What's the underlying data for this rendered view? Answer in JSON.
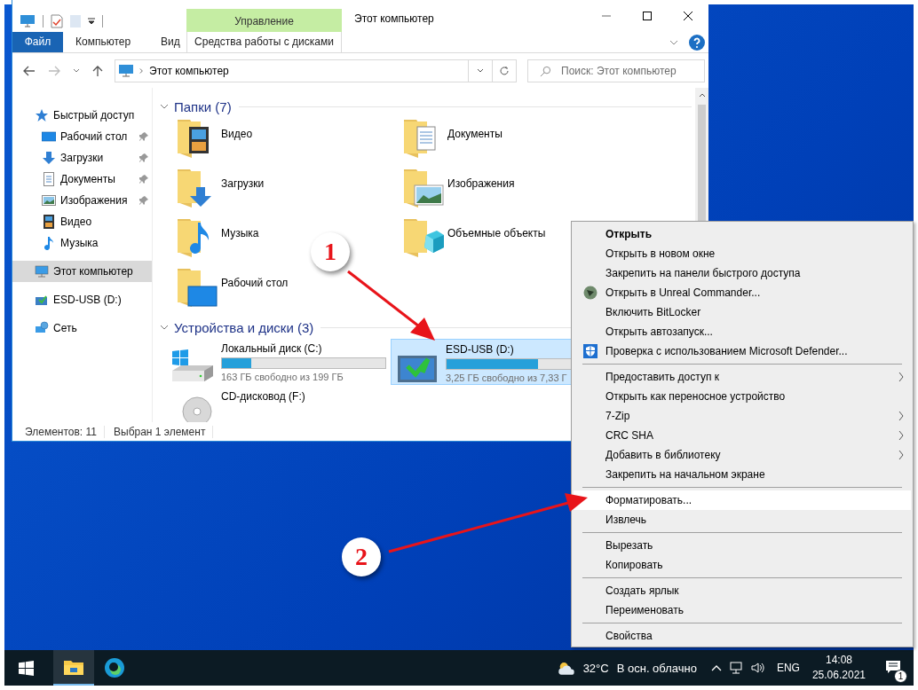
{
  "window": {
    "title": "Этот компьютер",
    "context_tab_group": "Управление"
  },
  "ribbon_tabs": [
    {
      "label": "Файл",
      "kind": "file",
      "selected": false
    },
    {
      "label": "Компьютер",
      "kind": "tab",
      "selected": false
    },
    {
      "label": "Вид",
      "kind": "tab",
      "selected": false
    },
    {
      "label": "Средства работы с дисками",
      "kind": "context",
      "selected": false
    }
  ],
  "address_bar": {
    "path": "Этот компьютер"
  },
  "search": {
    "placeholder": "Поиск: Этот компьютер"
  },
  "navigation": [
    {
      "label": "Быстрый доступ",
      "kind": "star",
      "selected": false,
      "children": [
        {
          "label": "Рабочий стол",
          "kind": "desktop",
          "pinned": true,
          "selected": false
        },
        {
          "label": "Загрузки",
          "kind": "downloads",
          "pinned": true,
          "selected": false
        },
        {
          "label": "Документы",
          "kind": "documents",
          "pinned": true,
          "selected": false
        },
        {
          "label": "Изображения",
          "kind": "images",
          "pinned": true,
          "selected": false
        },
        {
          "label": "Видео",
          "kind": "video",
          "pinned": false,
          "selected": false
        },
        {
          "label": "Музыка",
          "kind": "music",
          "pinned": false,
          "selected": false
        }
      ]
    },
    {
      "label": "Этот компьютер",
      "kind": "pc",
      "selected": true
    },
    {
      "label": "ESD-USB (D:)",
      "kind": "usb",
      "selected": false
    },
    {
      "label": "Сеть",
      "kind": "network",
      "selected": false
    }
  ],
  "folders_section": {
    "title": "Папки (7)",
    "expanded": true,
    "items": [
      {
        "name": "Видео",
        "kind": "video"
      },
      {
        "name": "Документы",
        "kind": "documents"
      },
      {
        "name": "Загрузки",
        "kind": "downloads"
      },
      {
        "name": "Изображения",
        "kind": "images"
      },
      {
        "name": "Музыка",
        "kind": "music"
      },
      {
        "name": "Объемные объекты",
        "kind": "objects3d"
      },
      {
        "name": "Рабочий стол",
        "kind": "desktop"
      }
    ]
  },
  "drives_section": {
    "title": "Устройства и диски (3)",
    "expanded": true,
    "items": [
      {
        "name": "Локальный диск (C:)",
        "kind": "system",
        "level": 0.18,
        "free": "163 ГБ свободно из 199 ГБ",
        "selected": false
      },
      {
        "name": "ESD-USB (D:)",
        "kind": "usb",
        "level": 0.56,
        "free": "3,25 ГБ свободно из 7,33 Г",
        "selected": true
      },
      {
        "name": "CD-дисковод (F:)",
        "kind": "cd",
        "selected": false
      }
    ]
  },
  "status_bar": [
    "Элементов: 11",
    "Выбран 1 элемент"
  ],
  "context_menu": {
    "groups": [
      [
        {
          "label": "Открыть",
          "kind": "plain",
          "default": true,
          "submenu": false,
          "selected": false
        },
        {
          "label": "Открыть в новом окне",
          "kind": "plain",
          "default": false,
          "submenu": false,
          "selected": false
        },
        {
          "label": "Закрепить на панели быстрого доступа",
          "kind": "plain",
          "default": false,
          "submenu": false,
          "selected": false
        },
        {
          "label": "Открыть в Unreal Commander...",
          "kind": "app",
          "default": false,
          "submenu": false,
          "selected": false
        },
        {
          "label": "Включить BitLocker",
          "kind": "plain",
          "default": false,
          "submenu": false,
          "selected": false
        },
        {
          "label": "Открыть автозапуск...",
          "kind": "plain",
          "default": false,
          "submenu": false,
          "selected": false
        },
        {
          "label": "Проверка с использованием Microsoft Defender...",
          "kind": "shield",
          "default": false,
          "submenu": false,
          "selected": false
        }
      ],
      [
        {
          "label": "Предоставить доступ к",
          "kind": "plain",
          "default": false,
          "submenu": true,
          "selected": false
        },
        {
          "label": "Открыть как переносное устройство",
          "kind": "plain",
          "default": false,
          "submenu": false,
          "selected": false
        },
        {
          "label": "7-Zip",
          "kind": "plain",
          "default": false,
          "submenu": true,
          "selected": false
        },
        {
          "label": "CRC SHA",
          "kind": "plain",
          "default": false,
          "submenu": true,
          "selected": false
        },
        {
          "label": "Добавить в библиотеку",
          "kind": "plain",
          "default": false,
          "submenu": true,
          "selected": false
        },
        {
          "label": "Закрепить на начальном экране",
          "kind": "plain",
          "default": false,
          "submenu": false,
          "selected": false
        }
      ],
      [
        {
          "label": "Форматировать...",
          "kind": "plain",
          "default": false,
          "submenu": false,
          "selected": true
        },
        {
          "label": "Извлечь",
          "kind": "plain",
          "default": false,
          "submenu": false,
          "selected": false
        }
      ],
      [
        {
          "label": "Вырезать",
          "kind": "plain",
          "default": false,
          "submenu": false,
          "selected": false
        },
        {
          "label": "Копировать",
          "kind": "plain",
          "default": false,
          "submenu": false,
          "selected": false
        }
      ],
      [
        {
          "label": "Создать ярлык",
          "kind": "plain",
          "default": false,
          "submenu": false,
          "selected": false
        },
        {
          "label": "Переименовать",
          "kind": "plain",
          "default": false,
          "submenu": false,
          "selected": false
        }
      ],
      [
        {
          "label": "Свойства",
          "kind": "plain",
          "default": false,
          "submenu": false,
          "selected": false
        }
      ]
    ]
  },
  "annotations": [
    {
      "label": "1"
    },
    {
      "label": "2"
    }
  ],
  "taskbar": {
    "apps": [
      {
        "kind": "explorer",
        "active": true
      },
      {
        "kind": "edge",
        "active": false
      }
    ],
    "weather": {
      "temperature": "32°C",
      "condition": "В осн. облачно"
    },
    "language": "ENG",
    "time": "14:08",
    "date": "25.06.2021",
    "notifications": "1"
  }
}
